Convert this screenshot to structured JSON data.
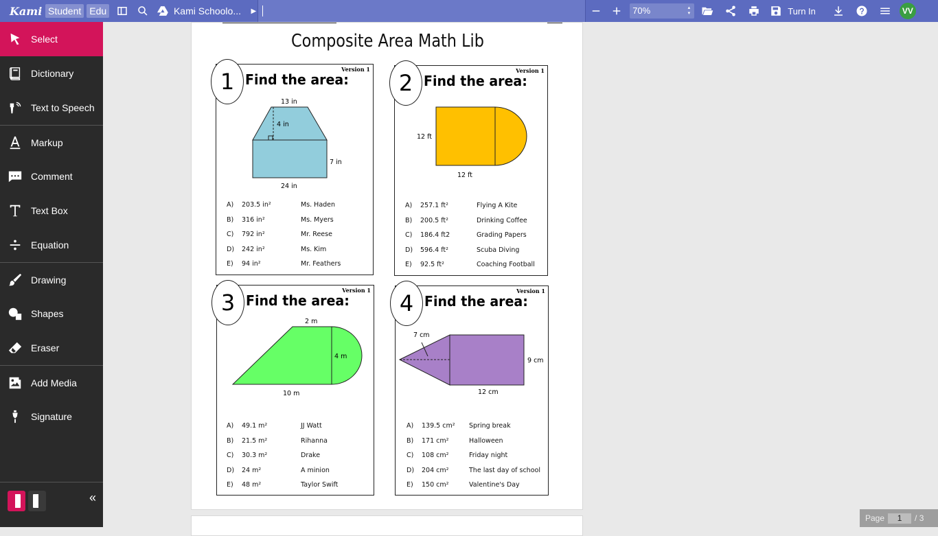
{
  "topbar": {
    "logo": "Kami",
    "role_student": "Student",
    "role_edu": "Edu",
    "file_name": "Kami Schoolo...",
    "zoom": "70%",
    "turn_in": "Turn In",
    "avatar": "VV"
  },
  "sidebar": {
    "tools": [
      {
        "label": "Select"
      },
      {
        "label": "Dictionary"
      },
      {
        "label": "Text to Speech"
      },
      {
        "label": "Markup"
      },
      {
        "label": "Comment"
      },
      {
        "label": "Text Box"
      },
      {
        "label": "Equation"
      },
      {
        "label": "Drawing"
      },
      {
        "label": "Shapes"
      },
      {
        "label": "Eraser"
      },
      {
        "label": "Add Media"
      },
      {
        "label": "Signature"
      }
    ],
    "collapse": "«"
  },
  "document": {
    "title": "Composite Area Math Lib",
    "cards": [
      {
        "number": "1",
        "version": "Version 1",
        "prompt": "Find the area:",
        "labels": [
          "13 in",
          "4 in",
          "7 in",
          "24 in"
        ],
        "answers": [
          {
            "letter": "A)",
            "value": "203.5 in²",
            "name": "Ms. Haden"
          },
          {
            "letter": "B)",
            "value": "316 in²",
            "name": "Ms. Myers"
          },
          {
            "letter": "C)",
            "value": "792 in²",
            "name": "Mr. Reese"
          },
          {
            "letter": "D)",
            "value": "242 in²",
            "name": "Ms. Kim"
          },
          {
            "letter": "E)",
            "value": "94 in²",
            "name": "Mr. Feathers"
          }
        ]
      },
      {
        "number": "2",
        "version": "Version 1",
        "prompt": "Find the area:",
        "labels": [
          "12 ft",
          "12 ft"
        ],
        "answers": [
          {
            "letter": "A)",
            "value": "257.1 ft²",
            "name": "Flying A Kite"
          },
          {
            "letter": "B)",
            "value": "200.5 ft²",
            "name": "Drinking Coffee"
          },
          {
            "letter": "C)",
            "value": "186.4 ft2",
            "name": "Grading Papers"
          },
          {
            "letter": "D)",
            "value": "596.4 ft²",
            "name": "Scuba Diving"
          },
          {
            "letter": "E)",
            "value": "92.5 ft²",
            "name": "Coaching Football"
          }
        ]
      },
      {
        "number": "3",
        "version": "Version 1",
        "prompt": "Find the area:",
        "labels": [
          "2 m",
          "4 m",
          "10 m"
        ],
        "answers": [
          {
            "letter": "A)",
            "value": "49.1 m²",
            "name": "JJ Watt"
          },
          {
            "letter": "B)",
            "value": "21.5 m²",
            "name": "Rihanna"
          },
          {
            "letter": "C)",
            "value": "30.3 m²",
            "name": "Drake"
          },
          {
            "letter": "D)",
            "value": "24 m²",
            "name": "A minion"
          },
          {
            "letter": "E)",
            "value": "48 m²",
            "name": "Taylor Swift"
          }
        ]
      },
      {
        "number": "4",
        "version": "Version 1",
        "prompt": "Find the area:",
        "labels": [
          "7 cm",
          "9 cm",
          "12 cm"
        ],
        "answers": [
          {
            "letter": "A)",
            "value": "139.5 cm²",
            "name": "Spring break"
          },
          {
            "letter": "B)",
            "value": "171 cm²",
            "name": "Halloween"
          },
          {
            "letter": "C)",
            "value": "108 cm²",
            "name": "Friday night"
          },
          {
            "letter": "D)",
            "value": "204 cm²",
            "name": "The last day of school"
          },
          {
            "letter": "E)",
            "value": "150 cm²",
            "name": "Valentine's Day"
          }
        ]
      }
    ]
  },
  "pager": {
    "label": "Page",
    "current": "1",
    "total": "/ 3"
  },
  "colors": {
    "topbar": "#5c6bc0",
    "sidebar": "#2a2a2a",
    "active_tool": "#d3145a",
    "fig1": "#92cddc",
    "fig2": "#ffc000",
    "fig3": "#66ff66",
    "fig4": "#a880c8"
  }
}
